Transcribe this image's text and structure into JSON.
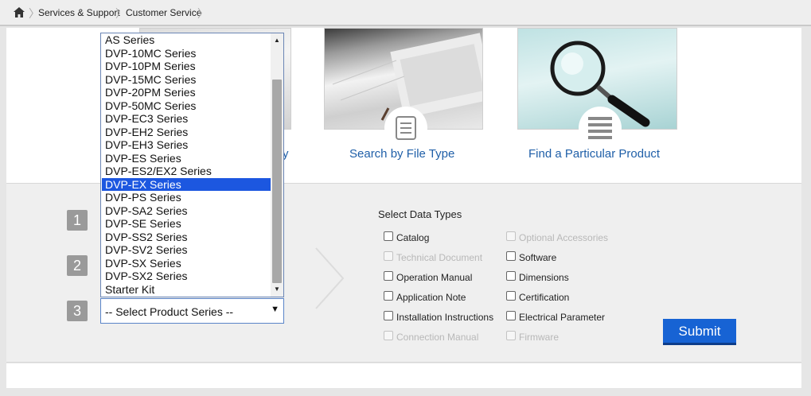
{
  "breadcrumb": {
    "items": [
      "Services & Support",
      "Customer Service"
    ]
  },
  "links": {
    "partial_text": "y",
    "file_type": "Search by File Type",
    "particular_product": "Find a Particular Product"
  },
  "steps": [
    "1",
    "2",
    "3"
  ],
  "dropdown": {
    "items": [
      "AS Series",
      "DVP-10MC Series",
      "DVP-10PM Series",
      "DVP-15MC Series",
      "DVP-20PM Series",
      "DVP-50MC Series",
      "DVP-EC3 Series",
      "DVP-EH2 Series",
      "DVP-EH3 Series",
      "DVP-ES Series",
      "DVP-ES2/EX2 Series",
      "DVP-EX Series",
      "DVP-PS Series",
      "DVP-SA2 Series",
      "DVP-SE Series",
      "DVP-SS2 Series",
      "DVP-SV2 Series",
      "DVP-SX Series",
      "DVP-SX2 Series",
      "Starter Kit"
    ],
    "highlighted": "DVP-EX Series"
  },
  "select": {
    "value": "-- Select Product Series --"
  },
  "data_types": {
    "label": "Select Data Types",
    "left": [
      {
        "label": "Catalog",
        "enabled": true
      },
      {
        "label": "Technical Document",
        "enabled": false
      },
      {
        "label": "Operation Manual",
        "enabled": true
      },
      {
        "label": "Application Note",
        "enabled": true
      },
      {
        "label": "Installation Instructions",
        "enabled": true
      },
      {
        "label": "Connection Manual",
        "enabled": false
      }
    ],
    "right": [
      {
        "label": "Optional Accessories",
        "enabled": false
      },
      {
        "label": "Software",
        "enabled": true
      },
      {
        "label": "Dimensions",
        "enabled": true
      },
      {
        "label": "Certification",
        "enabled": true
      },
      {
        "label": "Electrical Parameter",
        "enabled": true
      },
      {
        "label": "Firmware",
        "enabled": false
      }
    ]
  },
  "submit_label": "Submit",
  "colors": {
    "link": "#1f5fa8",
    "highlight": "#1c57e0",
    "submit": "#1763d4"
  }
}
